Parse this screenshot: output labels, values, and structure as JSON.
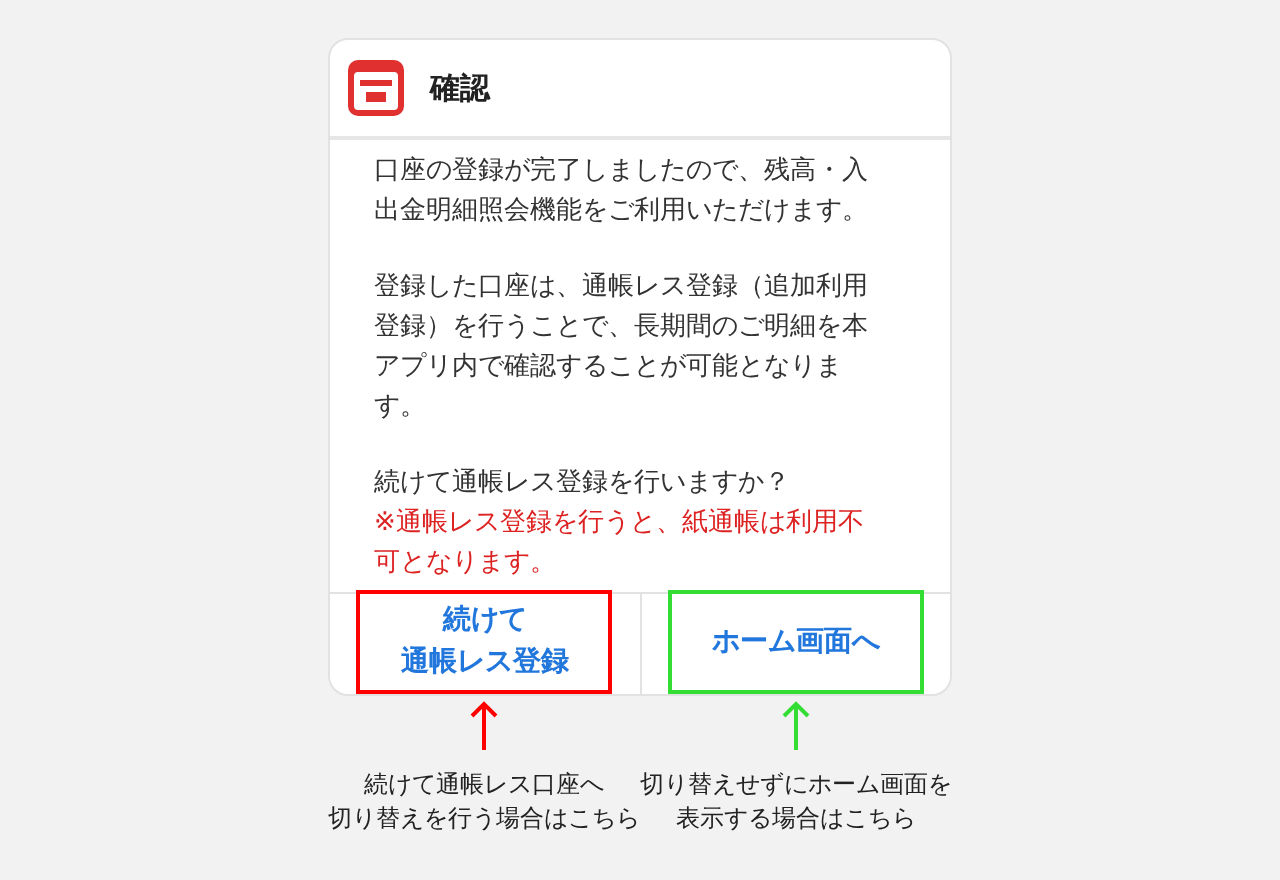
{
  "dialog": {
    "title": "確認",
    "paragraphs": [
      {
        "kind": "normal",
        "text": "口座の登録が完了しましたので、残高・入出金明細照会機能をご利用いただけます。"
      },
      {
        "kind": "normal",
        "text": "登録した口座は、通帳レス登録（追加利用登録）を行うことで、長期間のご明細を本アプリ内で確認することが可能となります。"
      },
      {
        "kind": "normal",
        "text": "続けて通帳レス登録を行いますか？"
      },
      {
        "kind": "warning",
        "text": "※通帳レス登録を行うと、紙通帳は利用不可となります。"
      }
    ],
    "buttons": [
      {
        "label_lines": [
          "続けて",
          "通帳レス登録"
        ],
        "color": "#ff0000",
        "caption_lines": [
          "続けて通帳レス口座へ",
          "切り替えを行う場合はこちら"
        ]
      },
      {
        "label_lines": [
          "ホーム画面へ"
        ],
        "color": "#33dd33",
        "caption_lines": [
          "切り替えせずにホーム画面を",
          "表示する場合はこちら"
        ]
      }
    ]
  }
}
